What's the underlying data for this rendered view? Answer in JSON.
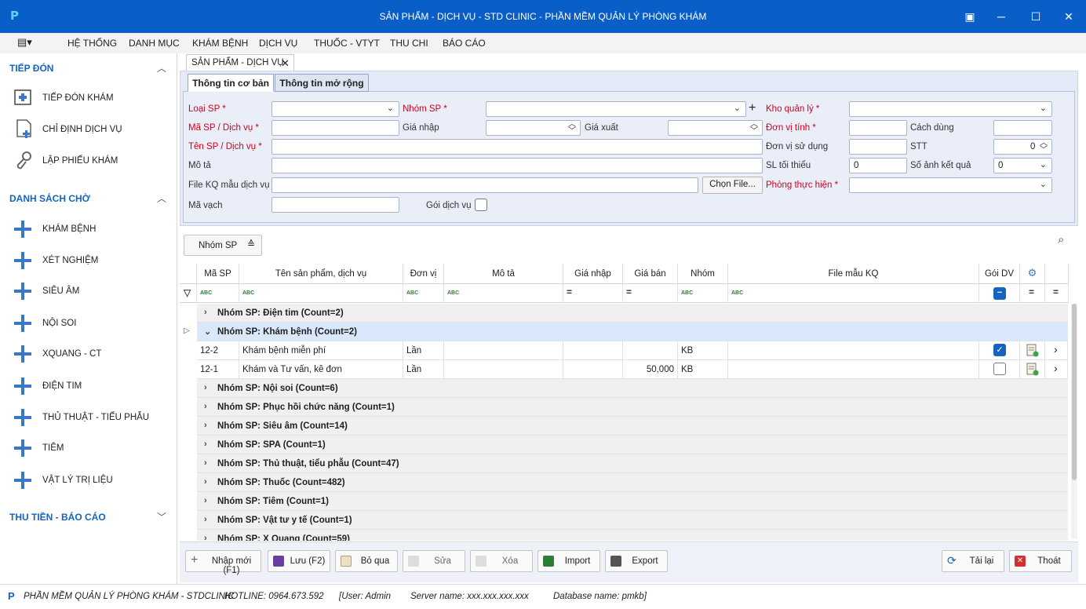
{
  "window": {
    "title": "SẢN PHẨM - DỊCH VỤ - STD CLINIC - PHẦN MỀM QUẢN LÝ PHÒNG KHÁM",
    "logo": "P"
  },
  "menu": [
    "HỆ THỐNG",
    "DANH MỤC",
    "KHÁM BỆNH",
    "DỊCH VỤ",
    "THUỐC - VTYT",
    "THU CHI",
    "BÁO CÁO"
  ],
  "sidebar": {
    "sec1": "TIẾP ĐÓN",
    "sec1_items": [
      "TIẾP ĐÓN KHÁM",
      "CHỈ ĐỊNH DỊCH VỤ",
      "LẬP PHIẾU KHÁM"
    ],
    "sec2": "DANH SÁCH CHỜ",
    "sec2_items": [
      "KHÁM BỆNH",
      "XÉT NGHIỆM",
      "SIÊU ÂM",
      "NỘI SOI",
      "XQUANG - CT",
      "ĐIỆN TIM",
      "THỦ THUẬT - TIỂU PHẪU",
      "TIÊM",
      "VẬT LÝ TRỊ LIỆU"
    ],
    "sec3": "THU TIỀN - BÁO CÁO"
  },
  "doc_tab": "SẢN PHẨM - DỊCH VỤ",
  "inner_tabs": [
    "Thông tin cơ bản",
    "Thông tin mở rộng"
  ],
  "form": {
    "loai_sp": "Loại SP *",
    "nhom_sp": "Nhóm SP *",
    "kho_quan_ly": "Kho quản lý *",
    "ma_sp": "Mã SP / Dịch vụ *",
    "gia_nhap": "Giá nhập",
    "gia_xuat": "Giá xuất",
    "don_vi_tinh": "Đơn vị tính *",
    "cach_dung": "Cách dùng",
    "ten_sp": "Tên SP / Dịch vụ *",
    "don_vi_su_dung": "Đơn vị sử dụng",
    "stt": "STT",
    "stt_value": "0",
    "mo_ta": "Mô tả",
    "sl_toi_thieu": "SL tối thiểu",
    "sl_toi_thieu_value": "0",
    "so_anh": "Số ảnh kết quả",
    "so_anh_value": "0",
    "file_kq": "File KQ mẫu dịch vụ",
    "chon_file": "Chọn File...",
    "phong_thuc_hien": "Phòng thực hiện *",
    "ma_vach": "Mã vạch",
    "goi_dich_vu": "Gói dịch vụ"
  },
  "group_panel": "Nhóm SP",
  "columns": [
    "Mã SP",
    "Tên sản phẩm, dịch vụ",
    "Đơn vị",
    "Mô tả",
    "Giá nhập",
    "Giá bán",
    "Nhóm",
    "File mẫu KQ",
    "Gói DV"
  ],
  "filter_abc": "ABC",
  "groups": [
    {
      "label": "Nhóm SP: Điện tim (Count=2)",
      "open": false
    },
    {
      "label": "Nhóm SP: Khám bệnh (Count=2)",
      "open": true
    },
    {
      "label": "Nhóm SP: Nội soi (Count=6)",
      "open": false
    },
    {
      "label": "Nhóm SP: Phục hồi chức năng (Count=1)",
      "open": false
    },
    {
      "label": "Nhóm SP: Siêu âm (Count=14)",
      "open": false
    },
    {
      "label": "Nhóm SP: SPA (Count=1)",
      "open": false
    },
    {
      "label": "Nhóm SP: Thủ thuật, tiểu phẫu (Count=47)",
      "open": false
    },
    {
      "label": "Nhóm SP: Thuốc (Count=482)",
      "open": false
    },
    {
      "label": "Nhóm SP: Tiêm (Count=1)",
      "open": false
    },
    {
      "label": "Nhóm SP: Vật tư y tế (Count=1)",
      "open": false
    },
    {
      "label": "Nhóm SP: X Quang (Count=59)",
      "open": false
    }
  ],
  "rows": [
    {
      "ma": "12-2",
      "ten": "Khám bệnh miễn phí",
      "dv": "Lần",
      "mota": "",
      "gianhap": "",
      "giaban": "",
      "nhom": "KB",
      "file": "",
      "goi": true
    },
    {
      "ma": "12-1",
      "ten": "Khám và Tư vấn, kê đơn",
      "dv": "Lần",
      "mota": "",
      "gianhap": "",
      "giaban": "50,000",
      "nhom": "KB",
      "file": "",
      "goi": false
    }
  ],
  "actions": [
    "Nhập mới (F1)",
    "Lưu (F2)",
    "Bỏ qua",
    "Sửa",
    "Xóa",
    "Import",
    "Export",
    "Tải lại",
    "Thoát"
  ],
  "status": {
    "app": "PHẦN MỀM QUẢN LÝ PHÒNG KHÁM - STDCLINIC",
    "hotline": "HOTLINE: 0964.673.592",
    "user": "[User: Admin",
    "server": "Server name: xxx.xxx.xxx.xxx",
    "db": "Database name: pmkb]"
  }
}
